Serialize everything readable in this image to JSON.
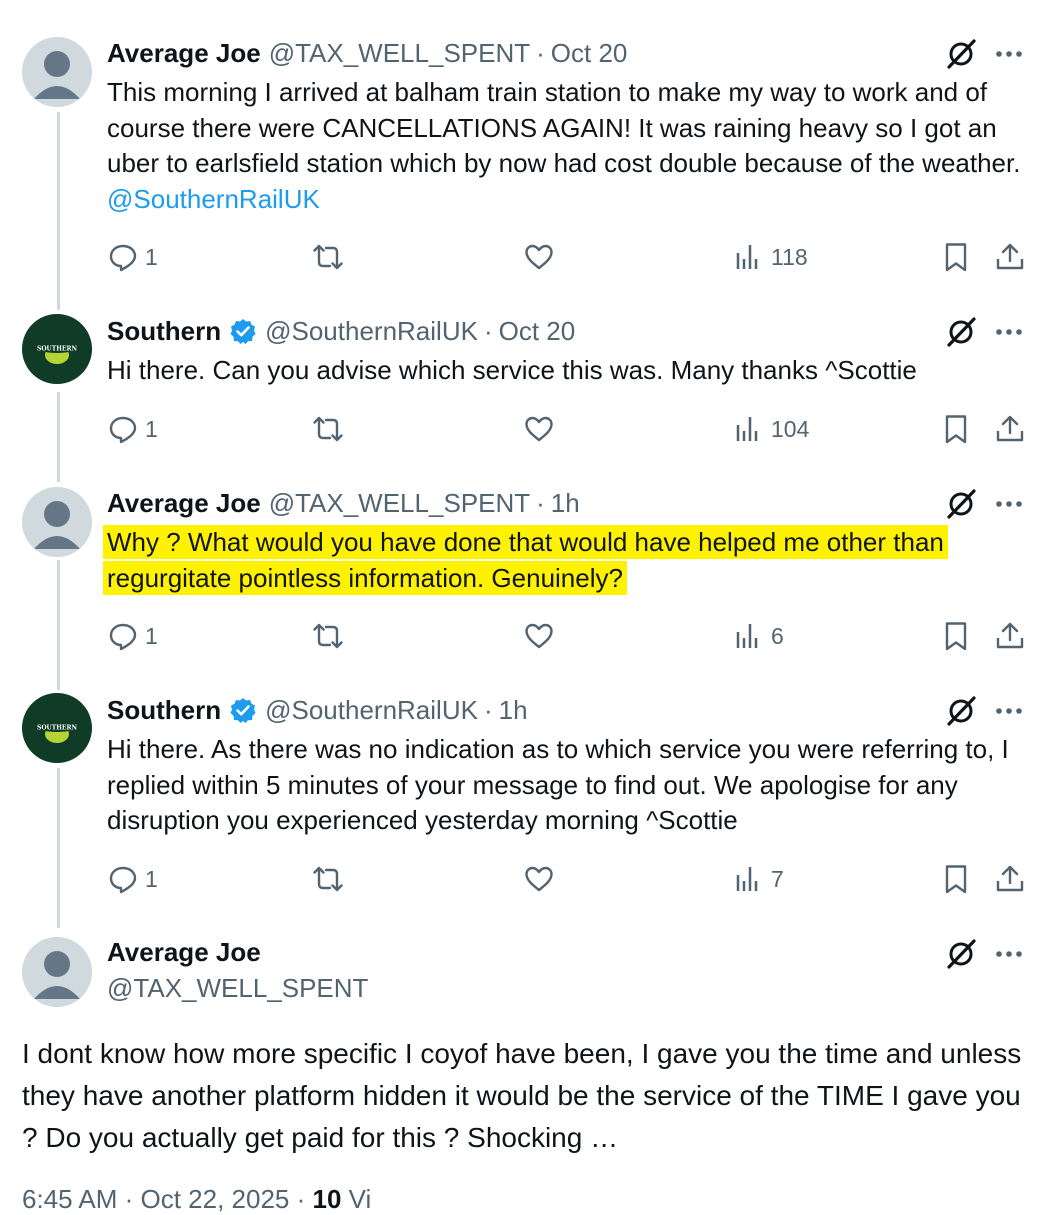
{
  "tweets": [
    {
      "name": "Average Joe",
      "handle": "@TAX_WELL_SPENT",
      "time": "Oct 20",
      "text": "This morning I arrived at balham train station to make my way to work and of course there were CANCELLATIONS AGAIN! It was raining heavy so I got an uber to earlsfield station which by now had cost double because of the weather.",
      "mention": "@SouthernRailUK",
      "replies": "1",
      "views": "118"
    },
    {
      "name": "Southern",
      "handle": "@SouthernRailUK",
      "time": "Oct 20",
      "text": "Hi there. Can you advise which service this was. Many thanks ^Scottie",
      "replies": "1",
      "views": "104"
    },
    {
      "name": "Average Joe",
      "handle": "@TAX_WELL_SPENT",
      "time": "1h",
      "text": "Why ? What would you have done that would have helped me other than regurgitate pointless information. Genuinely?",
      "replies": "1",
      "views": "6"
    },
    {
      "name": "Southern",
      "handle": "@SouthernRailUK",
      "time": "1h",
      "text": "Hi there. As there was no indication as to which service you were referring to, I replied within 5 minutes of your message to find out. We apologise for any disruption you experienced yesterday morning ^Scottie",
      "replies": "1",
      "views": "7"
    }
  ],
  "main_tweet": {
    "name": "Average Joe",
    "handle": "@TAX_WELL_SPENT",
    "text": "I dont know how more specific I coyof have been, I gave you the time and unless they have another platform hidden it would be the service of the TIME I gave you ? Do you actually get paid for this ? Shocking  …",
    "timestamp": "6:45 AM · Oct 22, 2025",
    "views": "10",
    "views_label": "Vi"
  },
  "avatar_logo_text": "SOUTHERN",
  "icons": {
    "reply": "reply-icon",
    "retweet": "retweet-icon",
    "like": "like-icon",
    "views": "views-icon",
    "bookmark": "bookmark-icon",
    "share": "share-icon",
    "grok": "grok-icon",
    "more": "more-icon",
    "verified": "verified-badge-icon"
  },
  "colors": {
    "text": "#0f1419",
    "muted": "#536471",
    "link": "#1d9bf0",
    "highlight": "#fff200",
    "southern_green": "#0f3b27",
    "thread_line": "#cfd9de"
  }
}
